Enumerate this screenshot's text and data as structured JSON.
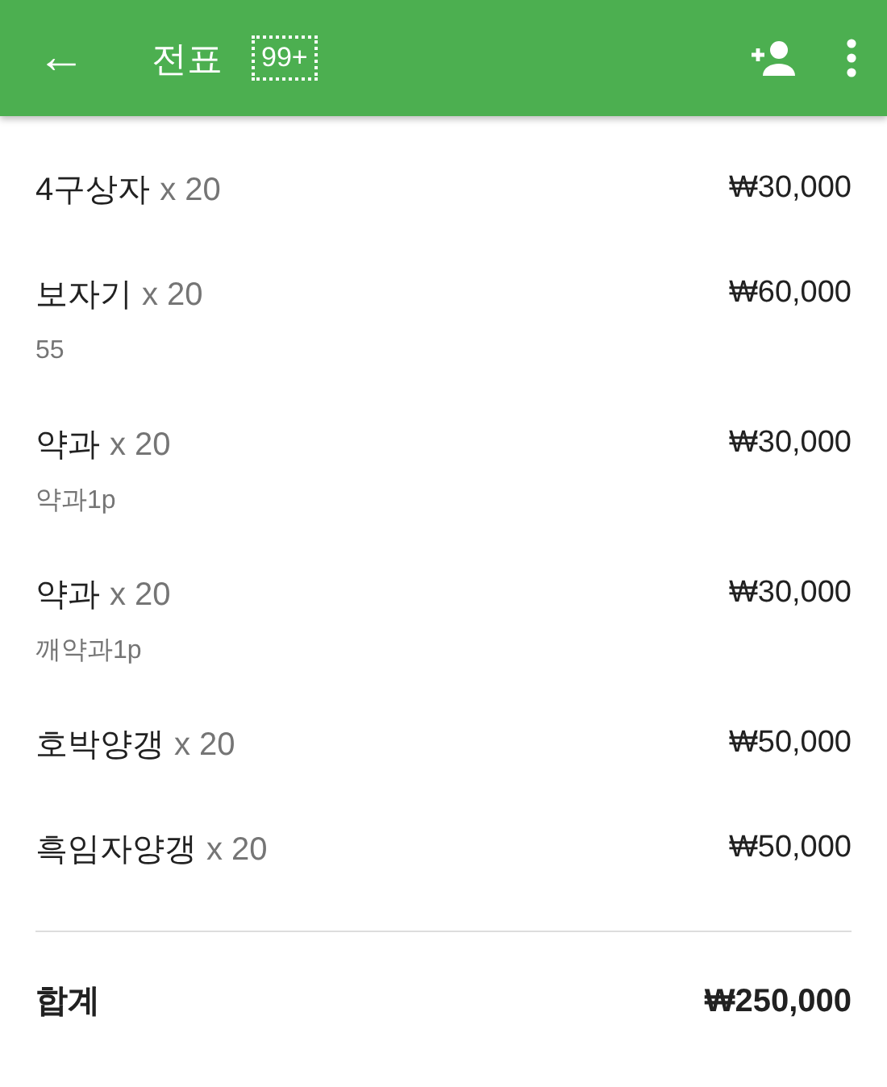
{
  "app_bar": {
    "back": "←",
    "title": "전표",
    "badge": "99+"
  },
  "items": [
    {
      "name": "4구상자",
      "quantity": "x 20",
      "price": "₩30,000"
    },
    {
      "name": "보자기",
      "quantity": "x 20",
      "note": "55",
      "price": "₩60,000"
    },
    {
      "name": "약과",
      "quantity": "x 20",
      "note": "약과1p",
      "price": "₩30,000"
    },
    {
      "name": "약과",
      "quantity": "x 20",
      "note": "깨약과1p",
      "price": "₩30,000"
    },
    {
      "name": "호박양갱",
      "quantity": "x 20",
      "price": "₩50,000"
    },
    {
      "name": "흑임자양갱",
      "quantity": "x 20",
      "price": "₩50,000"
    }
  ],
  "total": {
    "label": "합계",
    "amount": "₩250,000"
  }
}
